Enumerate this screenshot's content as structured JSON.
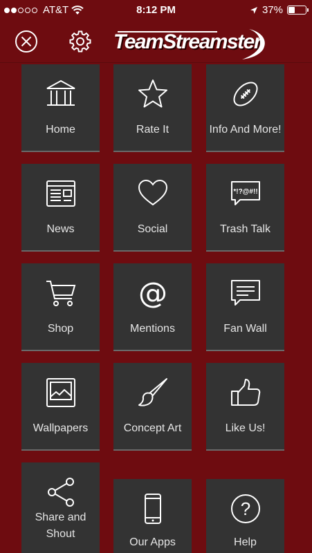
{
  "status_bar": {
    "carrier": "AT&T",
    "time": "8:12 PM",
    "battery": "37%",
    "battery_level": 0.37,
    "signal_bars_filled": 2
  },
  "header": {
    "logo_text": "TeamStreamster",
    "icons": [
      "close-icon",
      "gear-icon"
    ]
  },
  "colors": {
    "background": "#6e0c10",
    "tile": "#333333",
    "tile_text": "#e6e6e6"
  },
  "menu": {
    "items": [
      {
        "label": "Home",
        "icon": "home-icon"
      },
      {
        "label": "Rate It",
        "icon": "star-icon"
      },
      {
        "label": "Info And More!",
        "icon": "football-icon"
      },
      {
        "label": "News",
        "icon": "news-icon"
      },
      {
        "label": "Social",
        "icon": "heart-icon"
      },
      {
        "label": "Trash Talk",
        "icon": "trash-talk-icon",
        "icon_text": "*!?@#!!"
      },
      {
        "label": "Shop",
        "icon": "cart-icon"
      },
      {
        "label": "Mentions",
        "icon": "at-icon",
        "icon_text": "@"
      },
      {
        "label": "Fan Wall",
        "icon": "chat-icon"
      },
      {
        "label": "Wallpapers",
        "icon": "picture-icon"
      },
      {
        "label": "Concept Art",
        "icon": "paintbrush-icon"
      },
      {
        "label": "Like Us!",
        "icon": "thumbs-up-icon"
      },
      {
        "label": "Share and Shout",
        "icon": "share-icon"
      },
      {
        "label": "Our Apps",
        "icon": "phone-icon"
      },
      {
        "label": "Help",
        "icon": "help-icon",
        "icon_text": "?"
      }
    ]
  }
}
